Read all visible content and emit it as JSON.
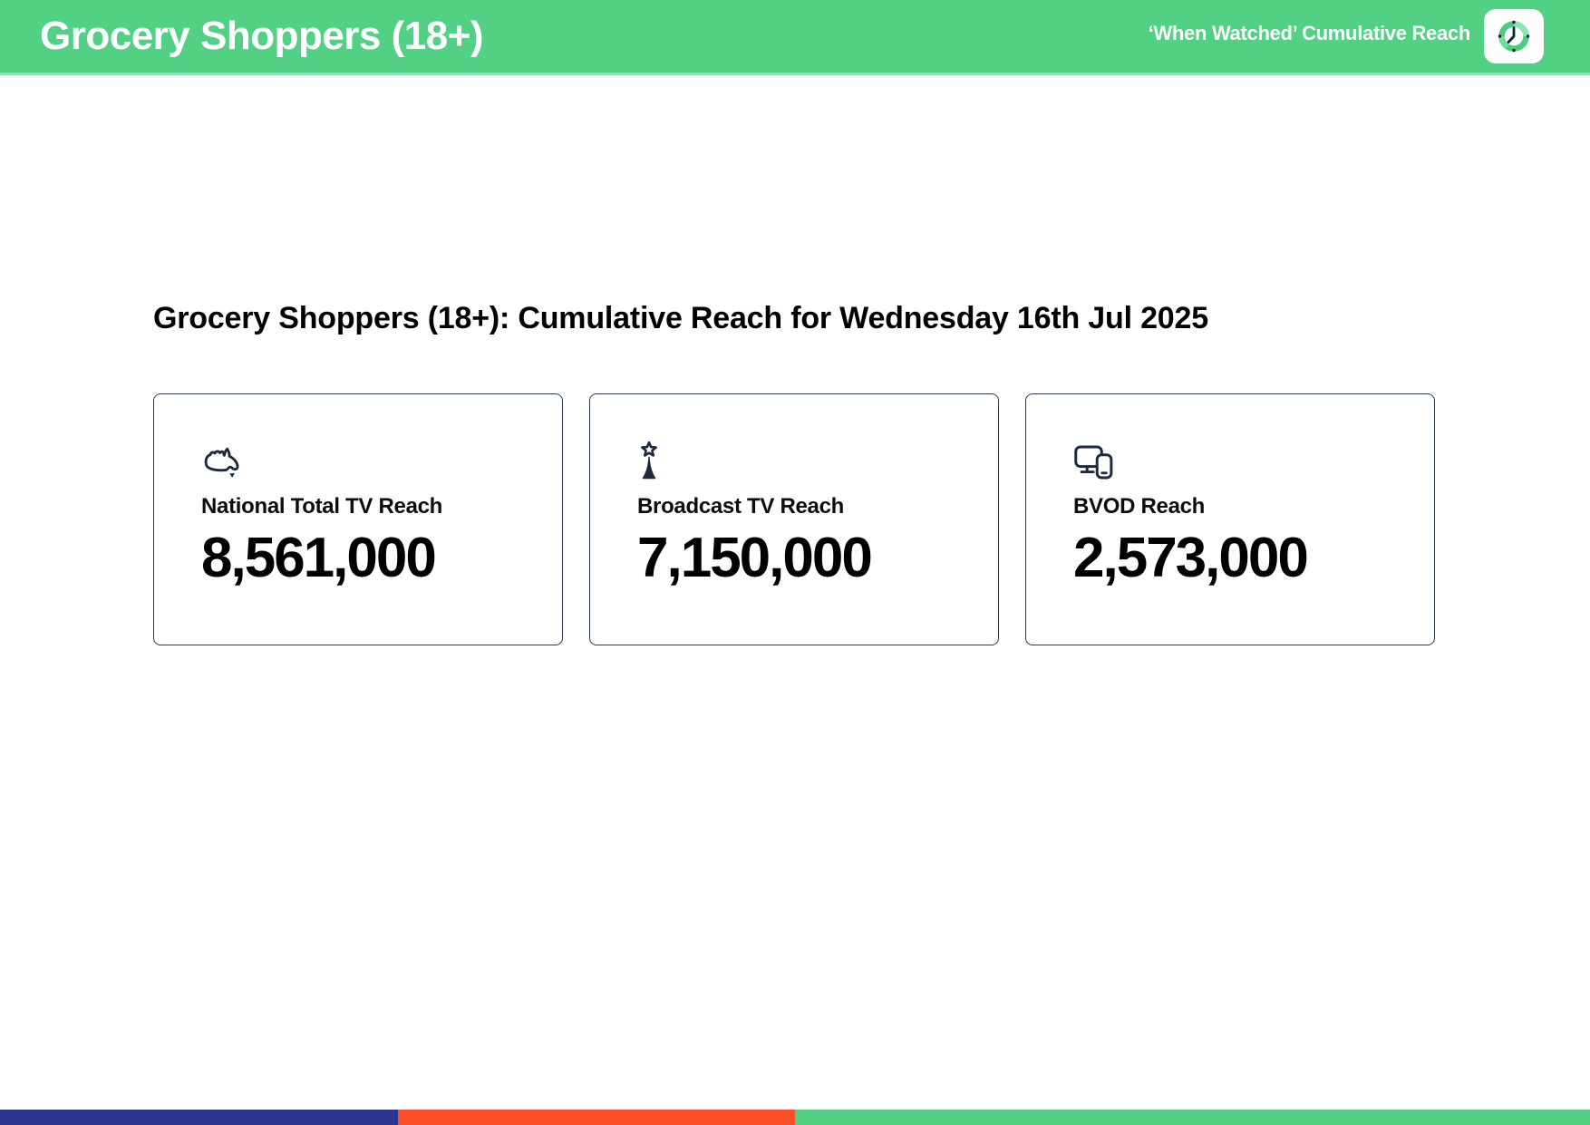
{
  "header": {
    "title": "Grocery Shoppers (18+)",
    "subtitle": "‘When Watched’ Cumulative Reach"
  },
  "main": {
    "heading": "Grocery Shoppers (18+): Cumulative Reach for Wednesday 16th Jul 2025",
    "cards": [
      {
        "icon": "australia-map-icon",
        "label": "National Total TV Reach",
        "value": "8,561,000"
      },
      {
        "icon": "broadcast-tower-icon",
        "label": "Broadcast TV Reach",
        "value": "7,150,000"
      },
      {
        "icon": "tv-and-phone-icon",
        "label": "BVOD Reach",
        "value": "2,573,000"
      }
    ]
  },
  "colors": {
    "header_green": "#52d185",
    "header_green_light": "#8be2b2",
    "icon_navy": "#1e2940",
    "card_border": "#2c3a52",
    "footer_blue": "#2d3592",
    "footer_orange": "#fa4f26",
    "footer_green": "#52d185"
  }
}
